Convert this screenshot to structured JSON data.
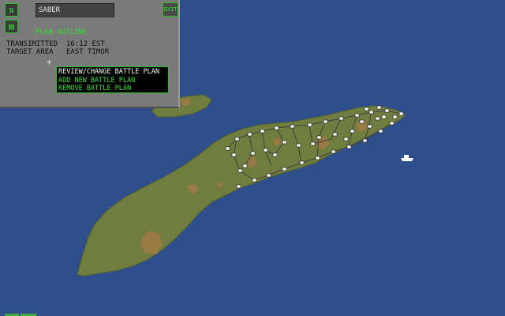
{
  "plan_name": "SABER",
  "exit_label": "EXIT",
  "section_title": "PLAN OUTLINE",
  "fields": {
    "transmitted_label": "TRANSIMITTED",
    "transmitted_value": "16:12 EST",
    "target_label": "TARGET AREA",
    "target_value": "EAST TIMOR"
  },
  "menu": {
    "items": [
      "REVIEW/CHANGE BATTLE PLAN",
      "ADD NEW BATTLE PLAN",
      "REMOVE BATTLE PLAN"
    ]
  },
  "colors": {
    "ocean": "#2e4f8c",
    "land": "#6f7d3f",
    "terrain": "#a27a45",
    "road": "#404040",
    "marker": "#ffffff",
    "ui_green": "#2fe02f",
    "panel": "#7a7a7a"
  },
  "icons": [
    "swap-arrows-icon",
    "list-icon",
    "cursor-crosshair-icon",
    "ship-icon"
  ]
}
